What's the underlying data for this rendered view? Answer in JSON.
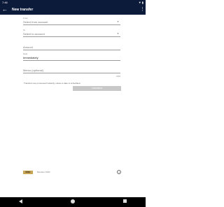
{
  "status_bar": {
    "time": "7:46",
    "icons": "▼ ▮"
  },
  "app_bar": {
    "back_icon": "←",
    "title": "New transfer",
    "more_icon": "⋮"
  },
  "form": {
    "from": {
      "label": "From",
      "placeholder": "Select from account",
      "dropdown_icon": "▼"
    },
    "to": {
      "label": "To",
      "placeholder": "Select to account",
      "dropdown_icon": "▼"
    },
    "amount": {
      "placeholder": "Amount"
    },
    "date": {
      "label": "Date",
      "value": "Immediately"
    },
    "memo": {
      "placeholder": "Memo (optional)",
      "counter": "0/32"
    },
    "info_text": "Transfers are processed instantly unless a date is scheduled.",
    "continue_label": "CONTINUE"
  },
  "bottom": {
    "badge": "FDIC",
    "text": "Member FDIC",
    "help_icon": "?"
  },
  "colors": {
    "header": "#0d1b3a",
    "accent": "#c8a653",
    "button_disabled": "#c8c8c8"
  }
}
